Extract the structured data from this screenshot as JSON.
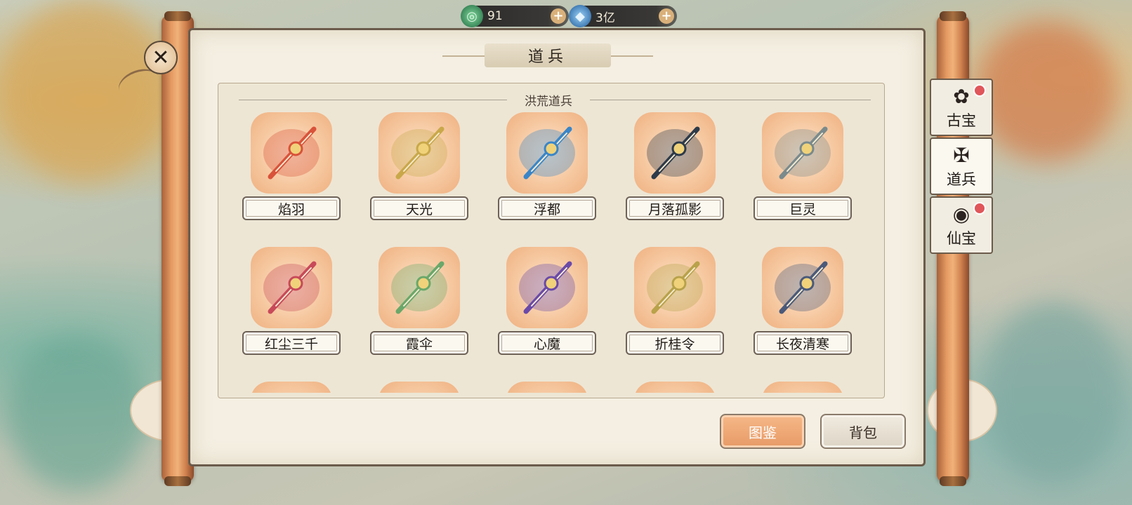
{
  "resources": [
    {
      "icon": "jade-coin-icon",
      "value": "91",
      "plus": "+"
    },
    {
      "icon": "blue-crystal-icon",
      "value": "3亿",
      "plus": "+"
    }
  ],
  "panel": {
    "title": "道兵",
    "section": "洪荒道兵"
  },
  "weapons": [
    {
      "name": "焰羽",
      "color": "#d9533a"
    },
    {
      "name": "天光",
      "color": "#c9a84a"
    },
    {
      "name": "浮都",
      "color": "#3a86c8"
    },
    {
      "name": "月落孤影",
      "color": "#2d3a4a"
    },
    {
      "name": "巨灵",
      "color": "#7a8a8c"
    },
    {
      "name": "红尘三千",
      "color": "#c84a5a"
    },
    {
      "name": "霞伞",
      "color": "#6aa86a"
    },
    {
      "name": "心魔",
      "color": "#6a4aa8"
    },
    {
      "name": "折桂令",
      "color": "#b8a24a"
    },
    {
      "name": "长夜清寒",
      "color": "#4a5a7a"
    }
  ],
  "buttons": {
    "primary": "图鉴",
    "secondary": "背包"
  },
  "side_tabs": [
    {
      "label": "古宝",
      "icon": "✿",
      "badge": true,
      "active": false
    },
    {
      "label": "道兵",
      "icon": "✠",
      "badge": false,
      "active": true
    },
    {
      "label": "仙宝",
      "icon": "◉",
      "badge": true,
      "active": false
    }
  ]
}
